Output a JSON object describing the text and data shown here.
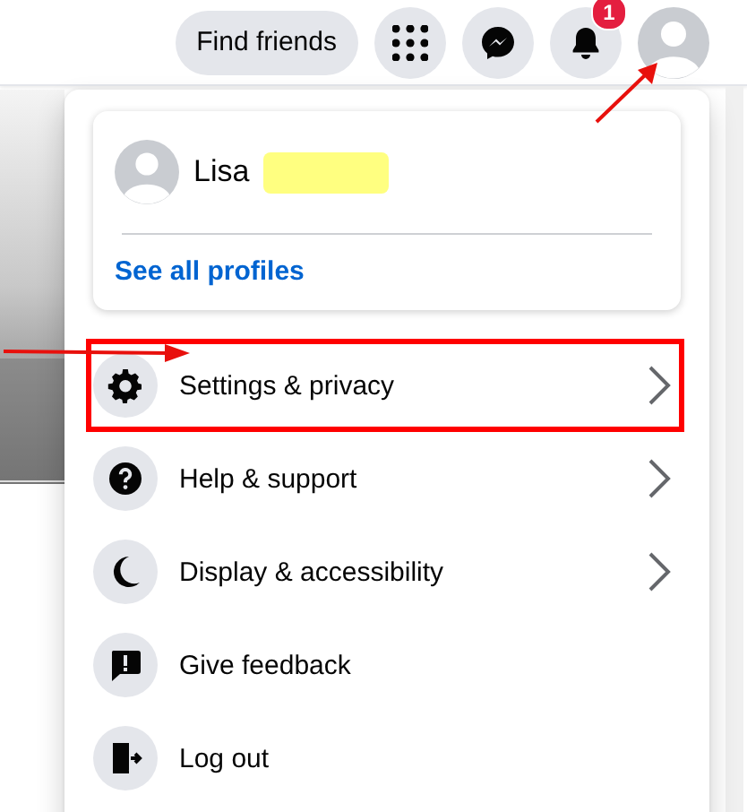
{
  "top_bar": {
    "find_friends": "Find friends",
    "notifications_badge": "1",
    "account_highlighted": true
  },
  "menu": {
    "profile": {
      "name": "Lisa",
      "surname_redacted": true,
      "link": "See all profiles"
    },
    "items": [
      {
        "kind": "settings",
        "label": "Settings & privacy",
        "has_submenu": true,
        "highlighted": true
      },
      {
        "kind": "help",
        "label": "Help & support",
        "has_submenu": true,
        "highlighted": false
      },
      {
        "kind": "display",
        "label": "Display & accessibility",
        "has_submenu": true,
        "highlighted": false
      },
      {
        "kind": "feedback",
        "label": "Give feedback",
        "has_submenu": false,
        "highlighted": false
      },
      {
        "kind": "logout",
        "label": "Log out",
        "has_submenu": false,
        "highlighted": false
      }
    ]
  }
}
